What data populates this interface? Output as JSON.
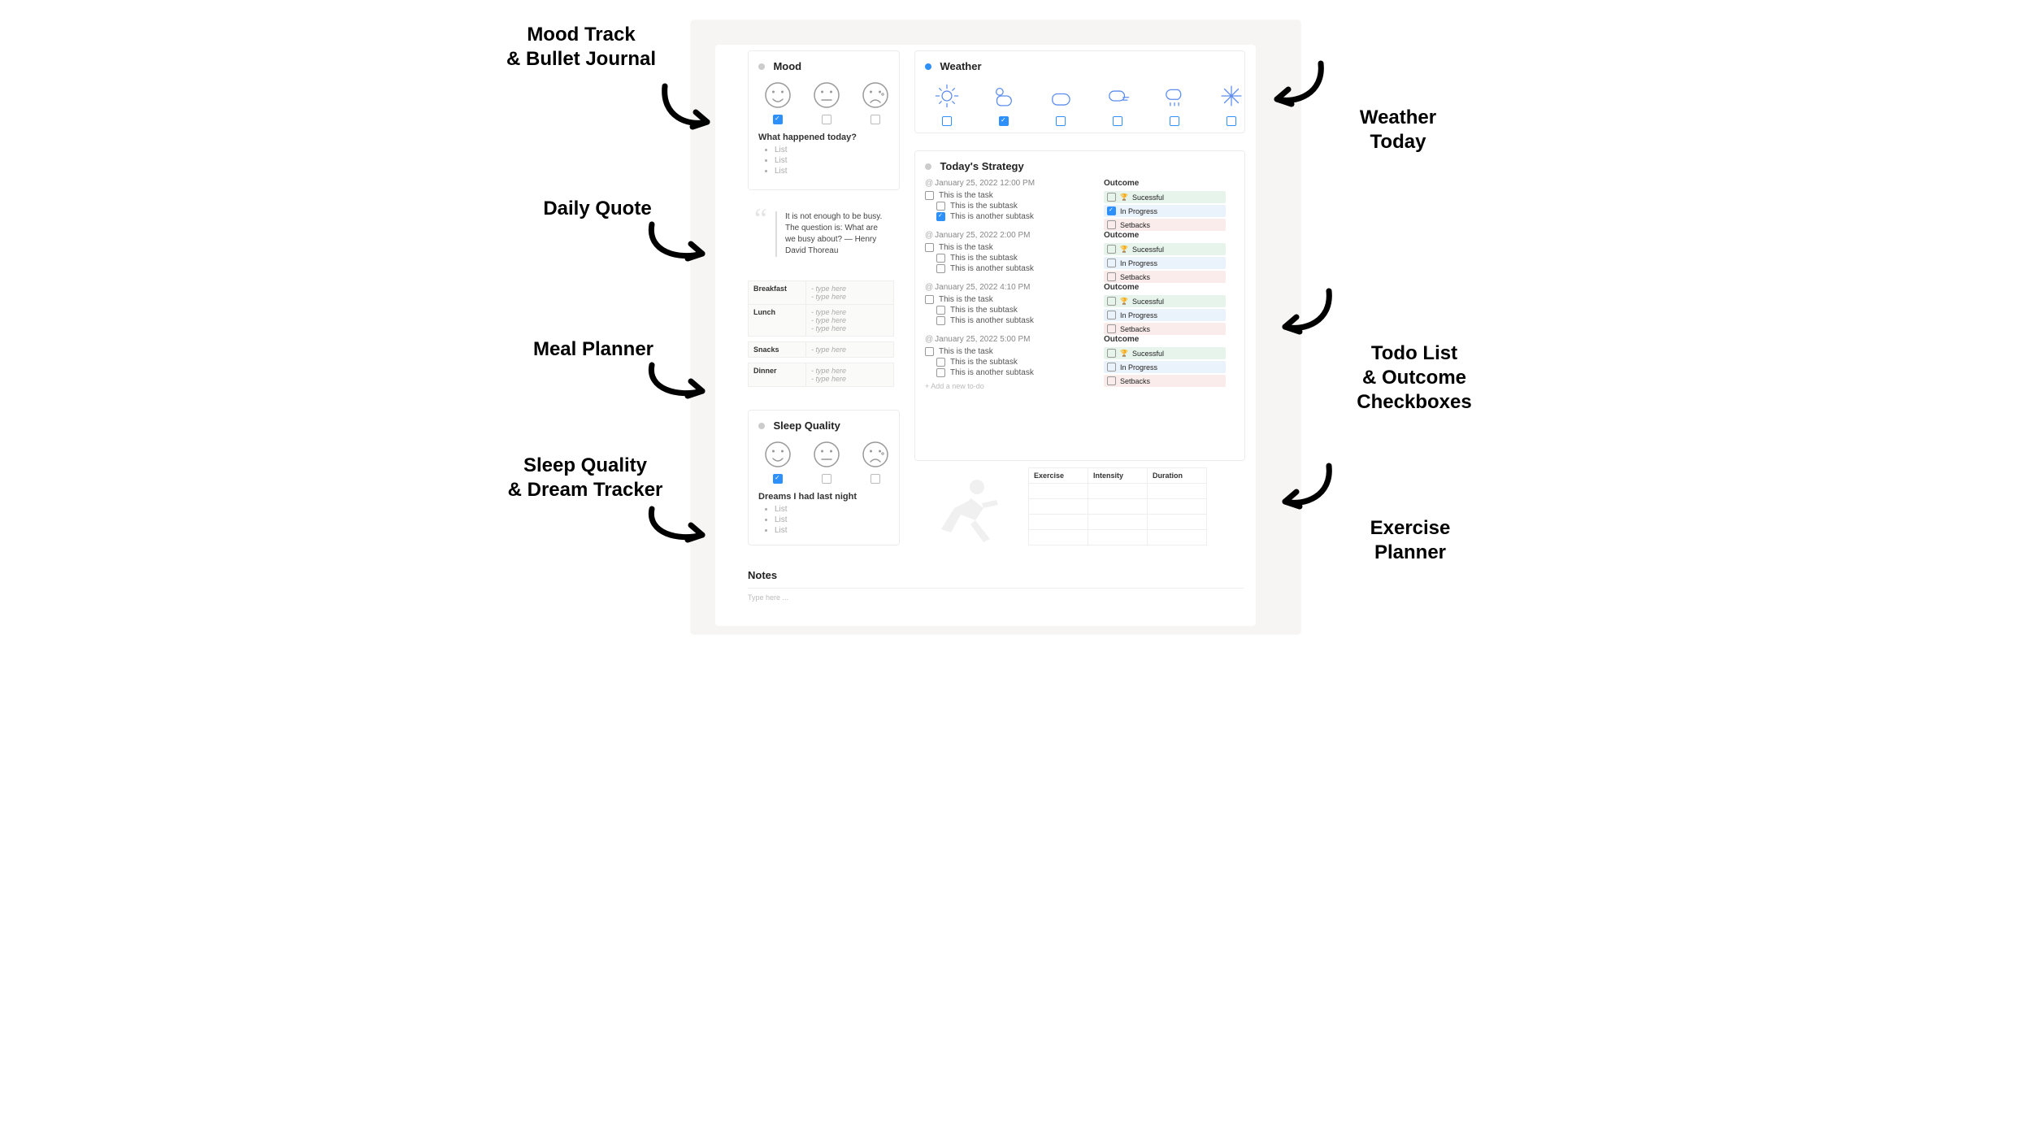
{
  "annotations": {
    "mood": "Mood Track\n& Bullet Journal",
    "quote": "Daily Quote",
    "meal": "Meal Planner",
    "sleep": "Sleep Quality\n& Dream Tracker",
    "weather": "Weather\nToday",
    "todo": "Todo List\n& Outcome\nCheckboxes",
    "exercise": "Exercise\nPlanner"
  },
  "mood": {
    "title": "Mood",
    "faces": [
      "happy",
      "neutral",
      "sad"
    ],
    "checked": 0,
    "journal_heading": "What happened today?",
    "journal_items": [
      "List",
      "List",
      "List"
    ]
  },
  "weather": {
    "title": "Weather",
    "icons": [
      "sunny",
      "partly-cloudy",
      "cloudy",
      "windy",
      "rainy",
      "snow"
    ],
    "checked": 1
  },
  "quote": {
    "text": "It is not enough to be busy. The question is: What are we busy about? — Henry David Thoreau"
  },
  "meals": {
    "rows": [
      {
        "label": "Breakfast",
        "lines": [
          "- type here",
          "- type here"
        ]
      },
      {
        "label": "Lunch",
        "lines": [
          "- type here",
          "- type here",
          "- type here"
        ]
      },
      {
        "label": "Snacks",
        "lines": [
          "- type here"
        ]
      },
      {
        "label": "Dinner",
        "lines": [
          "- type here",
          "- type here"
        ]
      }
    ]
  },
  "sleep": {
    "title": "Sleep Quality",
    "checked": 0,
    "dreams_heading": "Dreams I had last night",
    "dreams_items": [
      "List",
      "List",
      "List"
    ]
  },
  "strategy": {
    "title": "Today's Strategy",
    "blocks": [
      {
        "time": "January 25, 2022 12:00 PM",
        "task": "This is the task",
        "subs": [
          {
            "text": "This is the subtask",
            "checked": false
          },
          {
            "text": "This is another subtask",
            "checked": true
          }
        ],
        "outcomes": [
          {
            "text": "Sucessful",
            "checked": false,
            "icon": "🏆",
            "cls": "green"
          },
          {
            "text": "In Progress",
            "checked": true,
            "cls": "blue"
          },
          {
            "text": "Setbacks",
            "checked": false,
            "cls": "red"
          }
        ]
      },
      {
        "time": "January 25, 2022 2:00 PM",
        "task": "This is the task",
        "subs": [
          {
            "text": "This is the subtask",
            "checked": false
          },
          {
            "text": "This is another subtask",
            "checked": false
          }
        ],
        "outcomes": [
          {
            "text": "Sucessful",
            "checked": false,
            "icon": "🏆",
            "cls": "green"
          },
          {
            "text": "In Progress",
            "checked": false,
            "cls": "blue"
          },
          {
            "text": "Setbacks",
            "checked": false,
            "cls": "red"
          }
        ]
      },
      {
        "time": "January 25, 2022 4:10 PM",
        "task": "This is the task",
        "subs": [
          {
            "text": "This is the subtask",
            "checked": false
          },
          {
            "text": "This is another subtask",
            "checked": false
          }
        ],
        "outcomes": [
          {
            "text": "Sucessful",
            "checked": false,
            "icon": "🏆",
            "cls": "green"
          },
          {
            "text": "In Progress",
            "checked": false,
            "cls": "blue"
          },
          {
            "text": "Setbacks",
            "checked": false,
            "cls": "red"
          }
        ]
      },
      {
        "time": "January 25, 2022 5:00 PM",
        "task": "This is the task",
        "subs": [
          {
            "text": "This is the subtask",
            "checked": false
          },
          {
            "text": "This is another subtask",
            "checked": false
          }
        ],
        "outcomes": [
          {
            "text": "Sucessful",
            "checked": false,
            "icon": "🏆",
            "cls": "green"
          },
          {
            "text": "In Progress",
            "checked": false,
            "cls": "blue"
          },
          {
            "text": "Setbacks",
            "checked": false,
            "cls": "red"
          }
        ]
      }
    ],
    "add_new": "+  Add a new to-do"
  },
  "exercise": {
    "headers": [
      "Exercise",
      "Intensity",
      "Duration"
    ],
    "rows": 4
  },
  "notes": {
    "title": "Notes",
    "placeholder": "Type here ..."
  }
}
